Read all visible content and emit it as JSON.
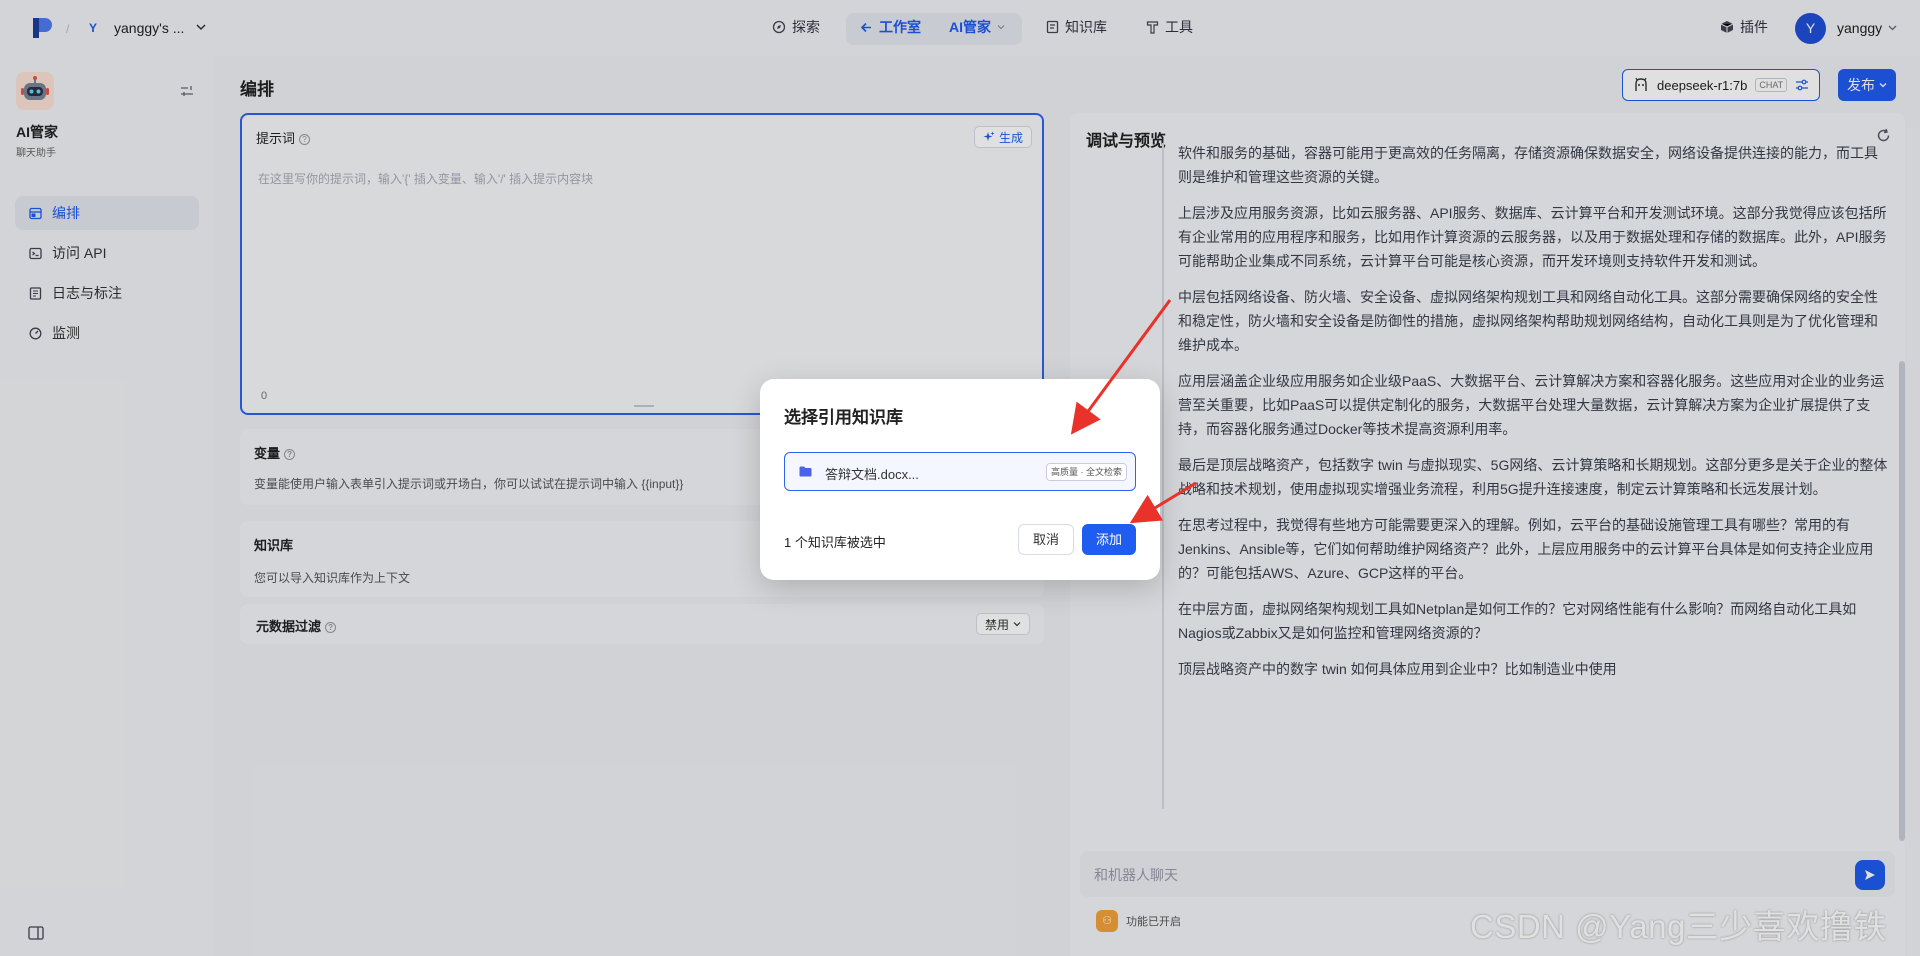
{
  "topbar": {
    "workspace_letter": "Y",
    "workspace_name": "yanggy's ...",
    "nav": {
      "explore": "探索",
      "workspace": "工作室",
      "current_app": "AI管家",
      "knowledge": "知识库",
      "tools": "工具"
    },
    "plugins": "插件",
    "user_initial": "Y",
    "user_name": "yanggy"
  },
  "sidebar": {
    "app_name": "AI管家",
    "app_type": "聊天助手",
    "items": [
      {
        "label": "编排",
        "icon": "layout-icon",
        "active": true
      },
      {
        "label": "访问 API",
        "icon": "terminal-icon",
        "active": false
      },
      {
        "label": "日志与标注",
        "icon": "log-icon",
        "active": false
      },
      {
        "label": "监测",
        "icon": "monitor-icon",
        "active": false
      }
    ]
  },
  "main": {
    "title": "编排",
    "model": {
      "name": "deepseek-r1:7b",
      "tag": "CHAT"
    },
    "publish": "发布",
    "prompt": {
      "label": "提示词",
      "generate": "生成",
      "placeholder": "在这里写你的提示词，输入'{' 插入变量、输入'/' 插入提示内容块",
      "count": "0"
    },
    "variables": {
      "label": "变量",
      "desc": "变量能使用户输入表单引入提示词或开场白，你可以试试在提示词中输入 {{input}}"
    },
    "knowledge": {
      "label": "知识库",
      "desc": "您可以导入知识库作为上下文"
    },
    "metadata_filter": {
      "label": "元数据过滤",
      "value": "禁用"
    }
  },
  "debug": {
    "title": "调试与预览",
    "paragraphs": [
      "部分包括基础设施、容器、存储资源和网络设备等。另外，还有基础设施管理工具。这些是底层，基础设施是运行软件和服务的基础，容器可能用于更高效的任务隔离，存储资源确保数据安全，网络设备提供连接的能力，而工具则是维护和管理这些资源的关键。",
      "上层涉及应用服务资源，比如云服务器、API服务、数据库、云计算平台和开发测试环境。这部分我觉得应该包括所有企业常用的应用程序和服务，比如用作计算资源的云服务器，以及用于数据处理和存储的数据库。此外，API服务可能帮助企业集成不同系统，云计算平台可能是核心资源，而开发环境则支持软件开发和测试。",
      "中层包括网络设备、防火墙、安全设备、虚拟网络架构规划工具和网络自动化工具。这部分需要确保网络的安全性和稳定性，防火墙和安全设备是防御性的措施，虚拟网络架构帮助规划网络结构，自动化工具则是为了优化管理和维护成本。",
      "应用层涵盖企业级应用服务如企业级PaaS、大数据平台、云计算解决方案和容器化服务。这些应用对企业的业务运营至关重要，比如PaaS可以提供定制化的服务，大数据平台处理大量数据，云计算解决方案为企业扩展提供了支持，而容器化服务通过Docker等技术提高资源利用率。",
      "最后是顶层战略资产，包括数字 twin 与虚拟现实、5G网络、云计算策略和长期规划。这部分更多是关于企业的整体战略和技术规划，使用虚拟现实增强业务流程，利用5G提升连接速度，制定云计算策略和长远发展计划。",
      "在思考过程中，我觉得有些地方可能需要更深入的理解。例如，云平台的基础设施管理工具有哪些？常用的有Jenkins、Ansible等，它们如何帮助维护网络资产？此外，上层应用服务中的云计算平台具体是如何支持企业应用的？可能包括AWS、Azure、GCP这样的平台。",
      "在中层方面，虚拟网络架构规划工具如Netplan是如何工作的？它对网络性能有什么影响？而网络自动化工具如Nagios或Zabbix又是如何监控和管理网络资源的？",
      "顶层战略资产中的数字 twin 如何具体应用到企业中？比如制造业中使用"
    ],
    "input_placeholder": "和机器人聊天",
    "feature_status": "功能已开启"
  },
  "modal": {
    "title": "选择引用知识库",
    "item_name": "答辩文档.docx...",
    "item_tag": "高质量 · 全文检索",
    "selected_status": "1 个知识库被选中",
    "cancel": "取消",
    "add": "添加"
  },
  "watermark": "CSDN @Yang三少喜欢撸铁",
  "colors": {
    "accent": "#1f5cf0",
    "annotation_arrow": "#e8322a"
  }
}
